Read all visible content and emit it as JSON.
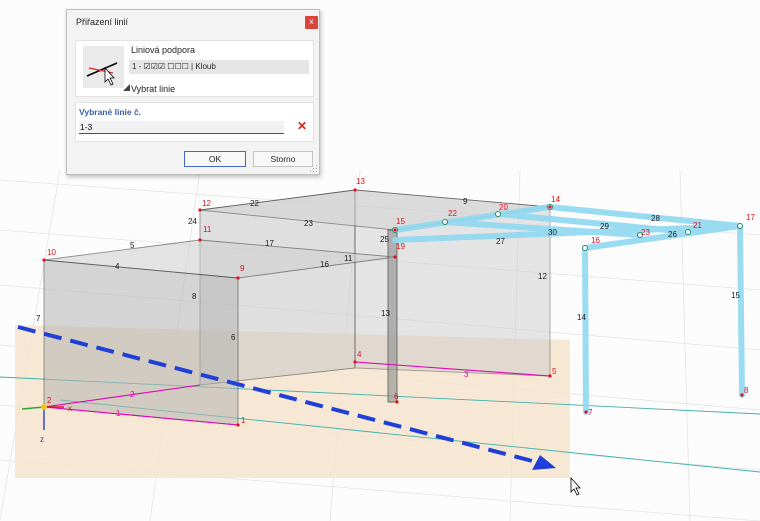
{
  "dialog": {
    "title": "Přiřazení linií",
    "close_label": "x",
    "support_label": "Liniová podpora",
    "support_value": "1 - ☑☑☑ ☐☐☐ | Kloub",
    "select_lines_label": "Vybrat linie",
    "selected_lines_heading": "Vybrané linie č.",
    "selected_lines_value": "1-3",
    "clear_symbol": "✕",
    "ok_label": "OK",
    "cancel_label": "Storno"
  },
  "model": {
    "node_labels": [
      "1",
      "2",
      "4",
      "5",
      "6",
      "7",
      "8",
      "9",
      "10",
      "11",
      "12",
      "13",
      "14",
      "15",
      "16",
      "17",
      "19",
      "20",
      "21",
      "22",
      "23"
    ],
    "line_labels": [
      "1",
      "2",
      "3",
      "4",
      "5",
      "6",
      "7",
      "8",
      "9",
      "11",
      "12",
      "13",
      "14",
      "15",
      "16",
      "17",
      "22",
      "23",
      "24",
      "25",
      "26",
      "27",
      "28",
      "29",
      "30"
    ],
    "axes": {
      "x": "x",
      "z": "z"
    }
  },
  "colors": {
    "accent": "#3a4fa3",
    "node_red": "#e0101e",
    "member_cyan": "#8fd9f2",
    "arrow_blue": "#1f3fd6",
    "support_line": "#e000b4"
  }
}
